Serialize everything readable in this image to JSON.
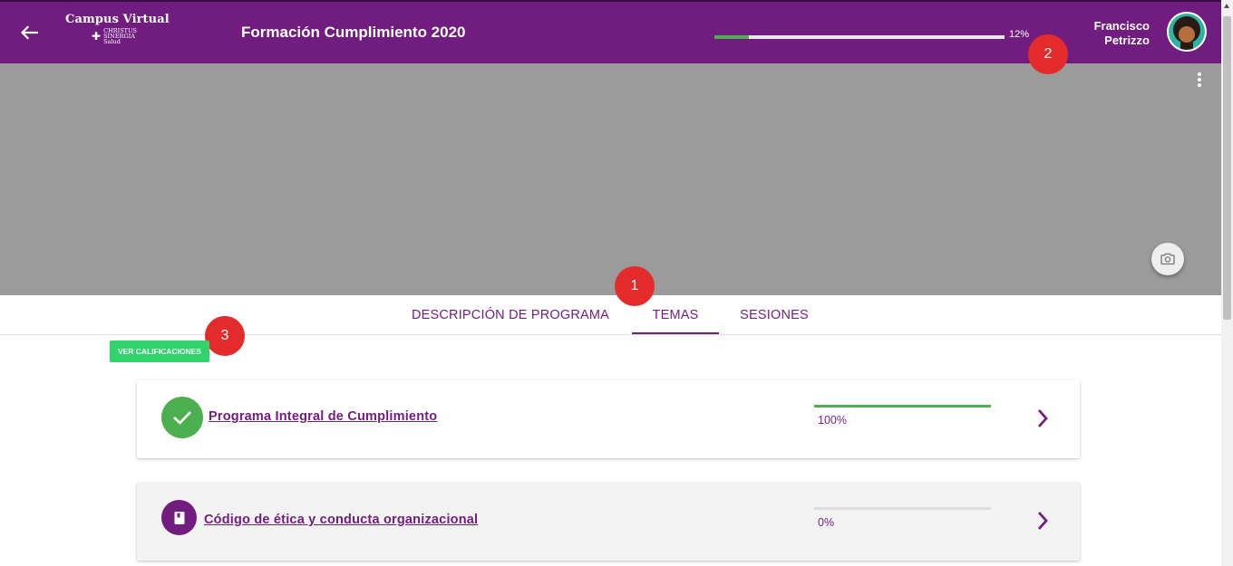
{
  "header": {
    "logo_title": "Campus Virtual",
    "logo_subtitle": "CHRISTUS\nSINERGIA\nSalud",
    "course_title": "Formación Cumplimiento 2020",
    "progress": 0.12,
    "progress_text": "12%",
    "user_name_first": "Francisco",
    "user_name_last": "Petrizzo",
    "icons": {
      "back": "arrow-left-icon",
      "menu": "more-vertical-icon",
      "camera": "camera-icon",
      "avatar": "avatar"
    }
  },
  "markers": [
    "1",
    "2",
    "3"
  ],
  "tabs": {
    "description": "DESCRIPCIÓN DE PROGRAMA",
    "topics": "TEMAS",
    "sessions": "SESIONES",
    "active": "TEMAS"
  },
  "grades_button": "VER CALIFICACIONES",
  "topics": [
    {
      "title": "Programa Integral de Cumplimiento",
      "progress": 1.0,
      "percent_text": "100%",
      "status_icon": "check-icon"
    },
    {
      "title": "Código de ética y conducta organizacional",
      "progress": 0.0,
      "percent_text": "0%",
      "status_icon": "book-icon"
    }
  ],
  "colors": {
    "primary": "#711c7f",
    "success": "#4caf50",
    "grades_button": "#2fd46a",
    "marker": "#e32b2b",
    "banner": "#9b9b9b"
  }
}
